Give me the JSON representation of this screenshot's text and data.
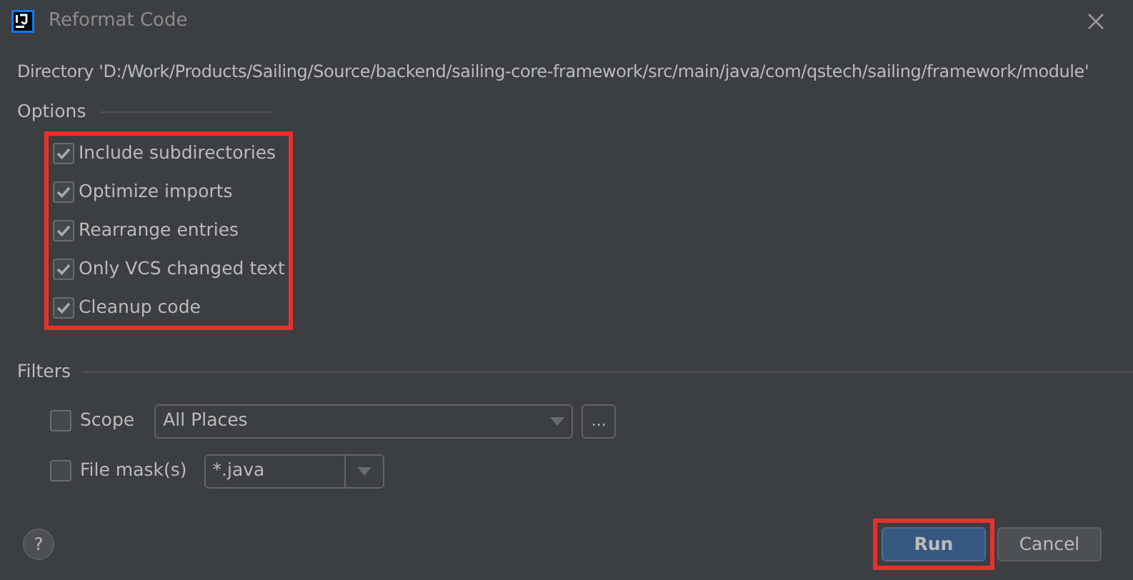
{
  "window": {
    "title": "Reformat Code"
  },
  "directory": "Directory 'D:/Work/Products/Sailing/Source/backend/sailing-core-framework/src/main/java/com/qstech/sailing/framework/module'",
  "options": {
    "title": "Options",
    "highlighted": true,
    "items": [
      {
        "label": "Include subdirectories",
        "checked": true
      },
      {
        "label": "Optimize imports",
        "checked": true
      },
      {
        "label": "Rearrange entries",
        "checked": true
      },
      {
        "label": "Only VCS changed text",
        "checked": true
      },
      {
        "label": "Cleanup code",
        "checked": true
      }
    ]
  },
  "filters": {
    "title": "Filters",
    "scope": {
      "label": "Scope",
      "checked": false,
      "value": "All Places",
      "browse": "..."
    },
    "file_mask": {
      "label": "File mask(s)",
      "checked": false,
      "value": "*.java"
    }
  },
  "help": "?",
  "buttons": [
    {
      "label": "Run",
      "kind": "primary",
      "highlighted": true
    },
    {
      "label": "Cancel",
      "kind": "secondary",
      "highlighted": false
    }
  ]
}
